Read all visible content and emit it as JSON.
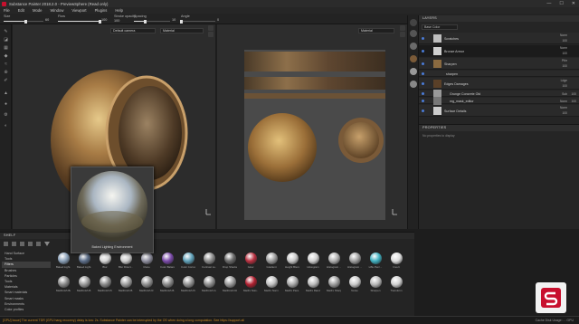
{
  "window": {
    "title": "Substance Painter 2018.2.0 - PreviewSphere (Read only)",
    "controls": [
      "—",
      "☐",
      "✕"
    ]
  },
  "menu": [
    "File",
    "Edit",
    "Mode",
    "Window",
    "Viewport",
    "Plugins",
    "Help"
  ],
  "toolprops": {
    "size": {
      "label": "Size",
      "value": "60",
      "level": 0.55
    },
    "flow": {
      "label": "Flow",
      "value": "100",
      "level": 1.0
    },
    "stroke_opacity": {
      "label": "Stroke opacity",
      "value": "100",
      "level": 1.0
    },
    "spacing": {
      "label": "Spacing",
      "value": "10",
      "level": 0.3
    },
    "angle": {
      "label": "Angle",
      "value": "0",
      "level": 0.0
    }
  },
  "viewport3d": {
    "camera_label": "Default camera",
    "mode_label": "Material"
  },
  "viewport2d": {
    "mode_label": "Material"
  },
  "layers": {
    "title": "LAYERS",
    "channel": "Base Color",
    "rows": [
      {
        "name": "Scratches",
        "blend": "Norm",
        "opacity": "100",
        "thumb": "#bfbfbf"
      },
      {
        "name": "Bronze Armor",
        "blend": "Norm",
        "opacity": "100",
        "thumb": "#d0d0d0",
        "selected": true
      },
      {
        "name": "Sharpen",
        "blend": "Pthr",
        "opacity": "100",
        "thumb": "#8a6a40"
      },
      {
        "name": "sharpen",
        "blend": "",
        "opacity": "",
        "thumb": ""
      },
      {
        "name": "Edges Damages",
        "blend": "Ldge",
        "opacity": "100",
        "thumb": "#5a4028"
      },
      {
        "name": "Grunge Concrete Old",
        "blend": "Sub",
        "opacity": "100",
        "thumb": "#999999"
      },
      {
        "name": "mg_mask_editor",
        "blend": "Norm",
        "opacity": "100",
        "thumb": "#777777"
      },
      {
        "name": "Surface Details",
        "blend": "Norm",
        "opacity": "100",
        "thumb": "#cccccc"
      }
    ]
  },
  "properties": {
    "title": "PROPERTIES",
    "hint": "No properties to display"
  },
  "shelf": {
    "title": "SHELF",
    "categories": [
      "Hand Surface",
      "Tools",
      "Filters",
      "Brushes",
      "Particles",
      "Tools",
      "Materials",
      "Smart materials",
      "Smart masks",
      "Environments",
      "Color profiles"
    ],
    "selected_category": "Filters",
    "row1": [
      {
        "label": "Baked Light...",
        "color": "#8aa0b8"
      },
      {
        "label": "Baked Light...",
        "color": "#5d6f8a"
      },
      {
        "label": "Blur",
        "color": "#d8d8d8"
      },
      {
        "label": "Blur Direct...",
        "color": "#cfcfcf"
      },
      {
        "label": "Clone",
        "color": "#9090a0"
      },
      {
        "label": "Color Balance",
        "color": "#7a4aa8"
      },
      {
        "label": "Color Correct",
        "color": "#5fa0b8"
      },
      {
        "label": "Contrast Lu...",
        "color": "#8a8a8a"
      },
      {
        "label": "Drop Shadow",
        "color": "#6a6a6a"
      },
      {
        "label": "Glow",
        "color": "#b83040"
      },
      {
        "label": "Gradient",
        "color": "#9a9a9a"
      },
      {
        "label": "Height Blend",
        "color": "#c8c8c8"
      },
      {
        "label": "Histogram",
        "color": "#d0d0d0"
      },
      {
        "label": "Histogram ...",
        "color": "#b0b0b0"
      },
      {
        "label": "Histogram ...",
        "color": "#a0a0a0"
      },
      {
        "label": "HSL Perc...",
        "color": "#40b0c0"
      },
      {
        "label": "Invert",
        "color": "#dddddd"
      }
    ],
    "row2": [
      {
        "label": "MatFinish Ba...",
        "color": "#8a8a8a"
      },
      {
        "label": "MatFinish B...",
        "color": "#9a9a9a"
      },
      {
        "label": "MatFinish Pu...",
        "color": "#888888"
      },
      {
        "label": "MatFinish B...",
        "color": "#9e9e9e"
      },
      {
        "label": "MatFinish R...",
        "color": "#8f8f8f"
      },
      {
        "label": "MatFinish B...",
        "color": "#8a8a8a"
      },
      {
        "label": "MatFinish Pa...",
        "color": "#939393"
      },
      {
        "label": "MatFinish G...",
        "color": "#8d8d8d"
      },
      {
        "label": "MatFinish Ra...",
        "color": "#999999"
      },
      {
        "label": "MatFx Nois...",
        "color": "#b02030"
      },
      {
        "label": "MatFx Normal",
        "color": "#c0c0c0"
      },
      {
        "label": "MatFx Para...",
        "color": "#a8a8a8"
      },
      {
        "label": "MatFx Rand...",
        "color": "#bcbcbc"
      },
      {
        "label": "MatFx Sharp...",
        "color": "#9c9c9c"
      },
      {
        "label": "Noise",
        "color": "#c8c8c8"
      },
      {
        "label": "Sharpen",
        "color": "#b8b8b8"
      },
      {
        "label": "Transform",
        "color": "#d0d0d0"
      }
    ]
  },
  "preview": {
    "caption": "Baked Lighting Environment"
  },
  "status": {
    "message": "[GPU] Issue] The current TDR (GPU hang recovery) delay is low: 2s. Substance Painter can be interrupted by the OS when doing a long computation. See https://support.all",
    "cache": "Cache Disk Usage:  ...  GPU"
  },
  "colors": {
    "accent_blue": "#4a7bd6",
    "warning_orange": "#c98a23",
    "brand_red": "#c8102e"
  }
}
